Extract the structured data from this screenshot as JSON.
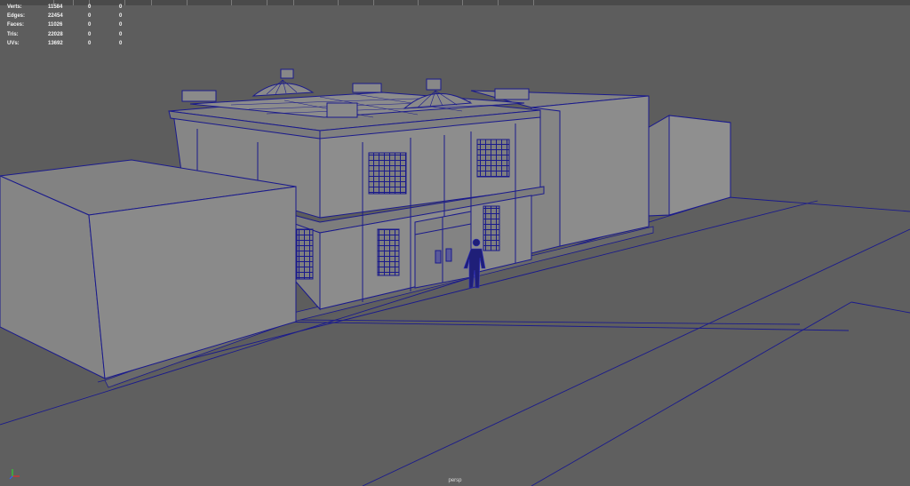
{
  "hud": {
    "rows": [
      {
        "label": "Verts:",
        "v1": "11584",
        "v2": "0",
        "v3": "0"
      },
      {
        "label": "Edges:",
        "v1": "22454",
        "v2": "0",
        "v3": "0"
      },
      {
        "label": "Faces:",
        "v1": "11026",
        "v2": "0",
        "v3": "0"
      },
      {
        "label": "Tris:",
        "v1": "22028",
        "v2": "0",
        "v3": "0"
      },
      {
        "label": "UVs:",
        "v1": "13692",
        "v2": "0",
        "v3": "0"
      }
    ]
  },
  "viewport": {
    "camera": "persp"
  },
  "colors": {
    "background": "#5d5d5d",
    "ground": "#5f5f5f",
    "wireframe": "#1a1a8c",
    "box_front": "#888888",
    "box_side": "#8f8f8f",
    "box_top": "#828282"
  },
  "icons": {
    "axis": "view-axis-gizmo-icon"
  }
}
